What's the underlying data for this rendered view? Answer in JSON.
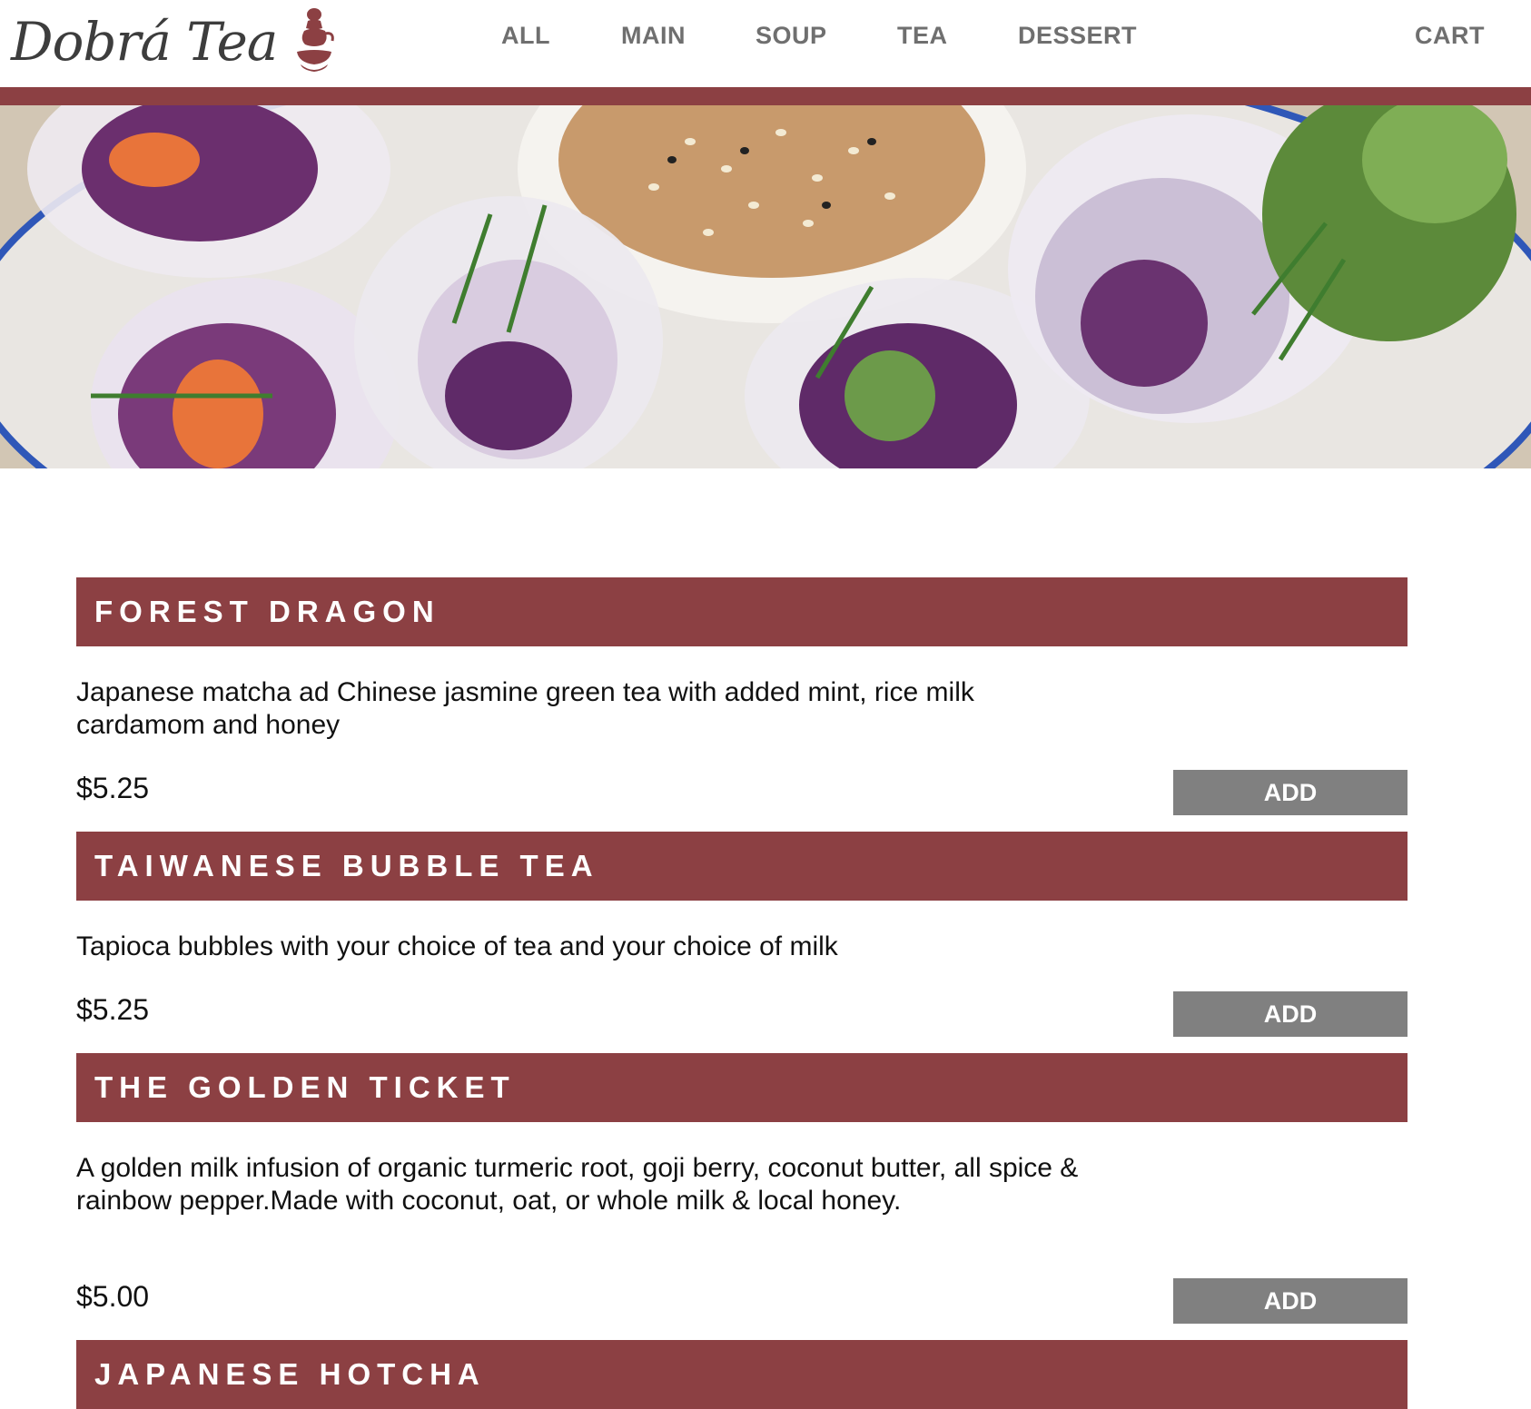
{
  "brand": {
    "name": "Dobrá Tea",
    "accent_color": "#8c4043",
    "nav_text_color": "#6f6f6f",
    "button_color": "#808080"
  },
  "nav": {
    "items": [
      {
        "label": "ALL"
      },
      {
        "label": "MAIN"
      },
      {
        "label": "SOUP"
      },
      {
        "label": "TEA"
      },
      {
        "label": "DESSERT"
      }
    ],
    "cart_label": "CART"
  },
  "hero": {
    "image": "spring-rolls-with-peanut-dipping-sauce-photo"
  },
  "menu": {
    "items": [
      {
        "title": "FOREST DRAGON",
        "description": "Japanese matcha ad Chinese jasmine green tea with added mint, rice milk cardamom and honey",
        "price": "$5.25",
        "button_label": "ADD"
      },
      {
        "title": "TAIWANESE BUBBLE TEA",
        "description": "Tapioca bubbles with your choice of tea and your choice of milk",
        "price": "$5.25",
        "button_label": "ADD"
      },
      {
        "title": "THE GOLDEN TICKET",
        "description": "A golden milk infusion of organic turmeric root, goji berry, coconut butter, all spice & rainbow pepper.Made with coconut, oat, or whole milk & local honey.",
        "price": "$5.00",
        "button_label": "ADD"
      },
      {
        "title": "JAPANESE HOTCHA"
      }
    ]
  }
}
